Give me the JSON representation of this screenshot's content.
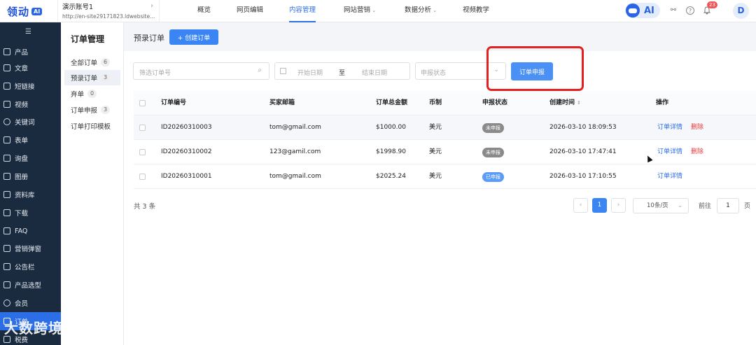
{
  "topbar": {
    "logo": "领动",
    "logo_badge": "AI",
    "account_name": "演示账号1",
    "account_url": "http://en-site29171823.ldwebsite....",
    "nav": [
      "概览",
      "网页编辑",
      "内容管理",
      "网站营销",
      "数据分析",
      "视频教学"
    ],
    "active_nav": "内容管理",
    "ai_label": "AI",
    "notification_count": "23",
    "avatar_letter": "D"
  },
  "sidebar": {
    "items": [
      "产品",
      "文章",
      "短链接",
      "视频",
      "关键词",
      "表单",
      "询盘",
      "图册",
      "资料库",
      "下载",
      "FAQ",
      "营销弹窗",
      "公告栏",
      "产品选型",
      "会员",
      "订单",
      "税费"
    ],
    "active": "订单"
  },
  "watermark": "大数跨境",
  "submenu": {
    "title": "订单管理",
    "items": [
      {
        "label": "全部订单",
        "count": "6"
      },
      {
        "label": "预录订单",
        "count": "3"
      },
      {
        "label": "弃单",
        "count": "0"
      },
      {
        "label": "订单申报",
        "count": "3"
      },
      {
        "label": "订单打印模板",
        "count": ""
      }
    ]
  },
  "main": {
    "page_title": "预录订单",
    "create_button": "+ 创建订单",
    "filters": {
      "order_no_placeholder": "筛选订单号",
      "start_date": "开始日期",
      "to": "至",
      "end_date": "结束日期",
      "status_placeholder": "申报状态"
    },
    "report_button": "订单申报",
    "table": {
      "headers": [
        "订单编号",
        "买家邮箱",
        "订单总金额",
        "币制",
        "申报状态",
        "创建时间",
        "操作"
      ],
      "rows": [
        {
          "id": "ID20260310003",
          "email": "tom@gmail.com",
          "amount": "$1000.00",
          "currency": "美元",
          "status": "未申报",
          "created": "2026-03-10 18:09:53",
          "detail": "订单详情",
          "delete": "删除"
        },
        {
          "id": "ID20260310002",
          "email": "123@gamil.com",
          "amount": "$1998.90",
          "currency": "美元",
          "status": "未申报",
          "created": "2026-03-10 17:47:41",
          "detail": "订单详情",
          "delete": "删除"
        },
        {
          "id": "ID20260310001",
          "email": "tom@gmail.com",
          "amount": "$2025.24",
          "currency": "美元",
          "status": "已申报",
          "created": "2026-03-10 17:10:55",
          "detail": "订单详情",
          "delete": ""
        }
      ]
    },
    "pagination": {
      "total": "共 3 条",
      "current_page": "1",
      "page_size": "10条/页",
      "goto_label": "前往",
      "goto_value": "1",
      "page_suffix": "页"
    },
    "colors": {
      "accent": "#3a84f3",
      "unreported": "#8a8a8a",
      "reported": "#5b9cf6",
      "highlight": "#e52020"
    }
  }
}
